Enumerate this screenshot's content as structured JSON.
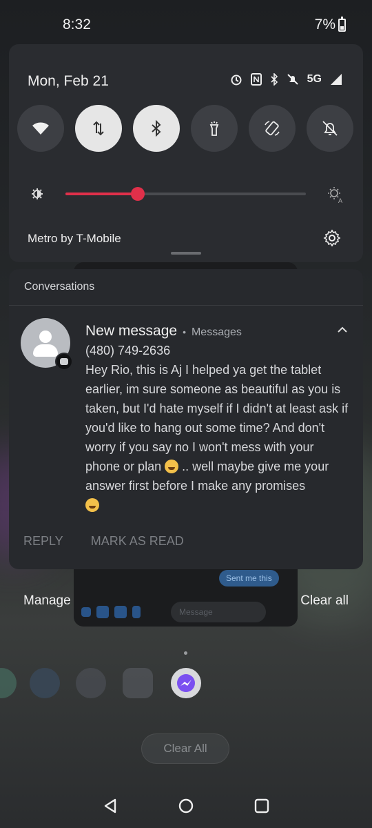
{
  "status_bar": {
    "time": "8:32",
    "battery": "7%"
  },
  "quick_settings": {
    "date": "Mon, Feb 21",
    "network": "5G",
    "tiles": [
      {
        "name": "wifi",
        "icon": "wifi-icon",
        "on": false
      },
      {
        "name": "mobile-data",
        "icon": "data-arrows-icon",
        "on": true
      },
      {
        "name": "bluetooth",
        "icon": "bluetooth-icon",
        "on": true
      },
      {
        "name": "flashlight",
        "icon": "flashlight-icon",
        "on": false
      },
      {
        "name": "auto-rotate",
        "icon": "rotate-icon",
        "on": false
      },
      {
        "name": "dnd",
        "icon": "bell-off-icon",
        "on": false
      }
    ],
    "brightness_level": 0.3,
    "carrier": "Metro by T-Mobile",
    "accent_color": "#e0304a"
  },
  "notification_group": {
    "header": "Conversations",
    "title": "New message",
    "separator": "•",
    "app": "Messages",
    "sender": "(480) 749-2636",
    "body_1": "Hey Rio, this is Aj I helped ya get the tablet earlier, im sure someone as beautiful as you is taken, but I'd hate myself if I didn't at least ask if you'd like to hang out some time? And don't worry if you say no I won't mess with your phone or plan",
    "body_2": " .. well maybe give me your answer first before I make any promises",
    "emoji_1": "grinning-squint-face",
    "emoji_2": "winking-face",
    "actions": {
      "reply": "REPLY",
      "mark_read": "MARK AS READ"
    }
  },
  "shade_footer": {
    "manage": "Manage",
    "clear_all": "Clear all"
  },
  "background": {
    "sent_bubble": "Sent me this",
    "message_placeholder": "Message",
    "recents_clear_all": "Clear All"
  }
}
